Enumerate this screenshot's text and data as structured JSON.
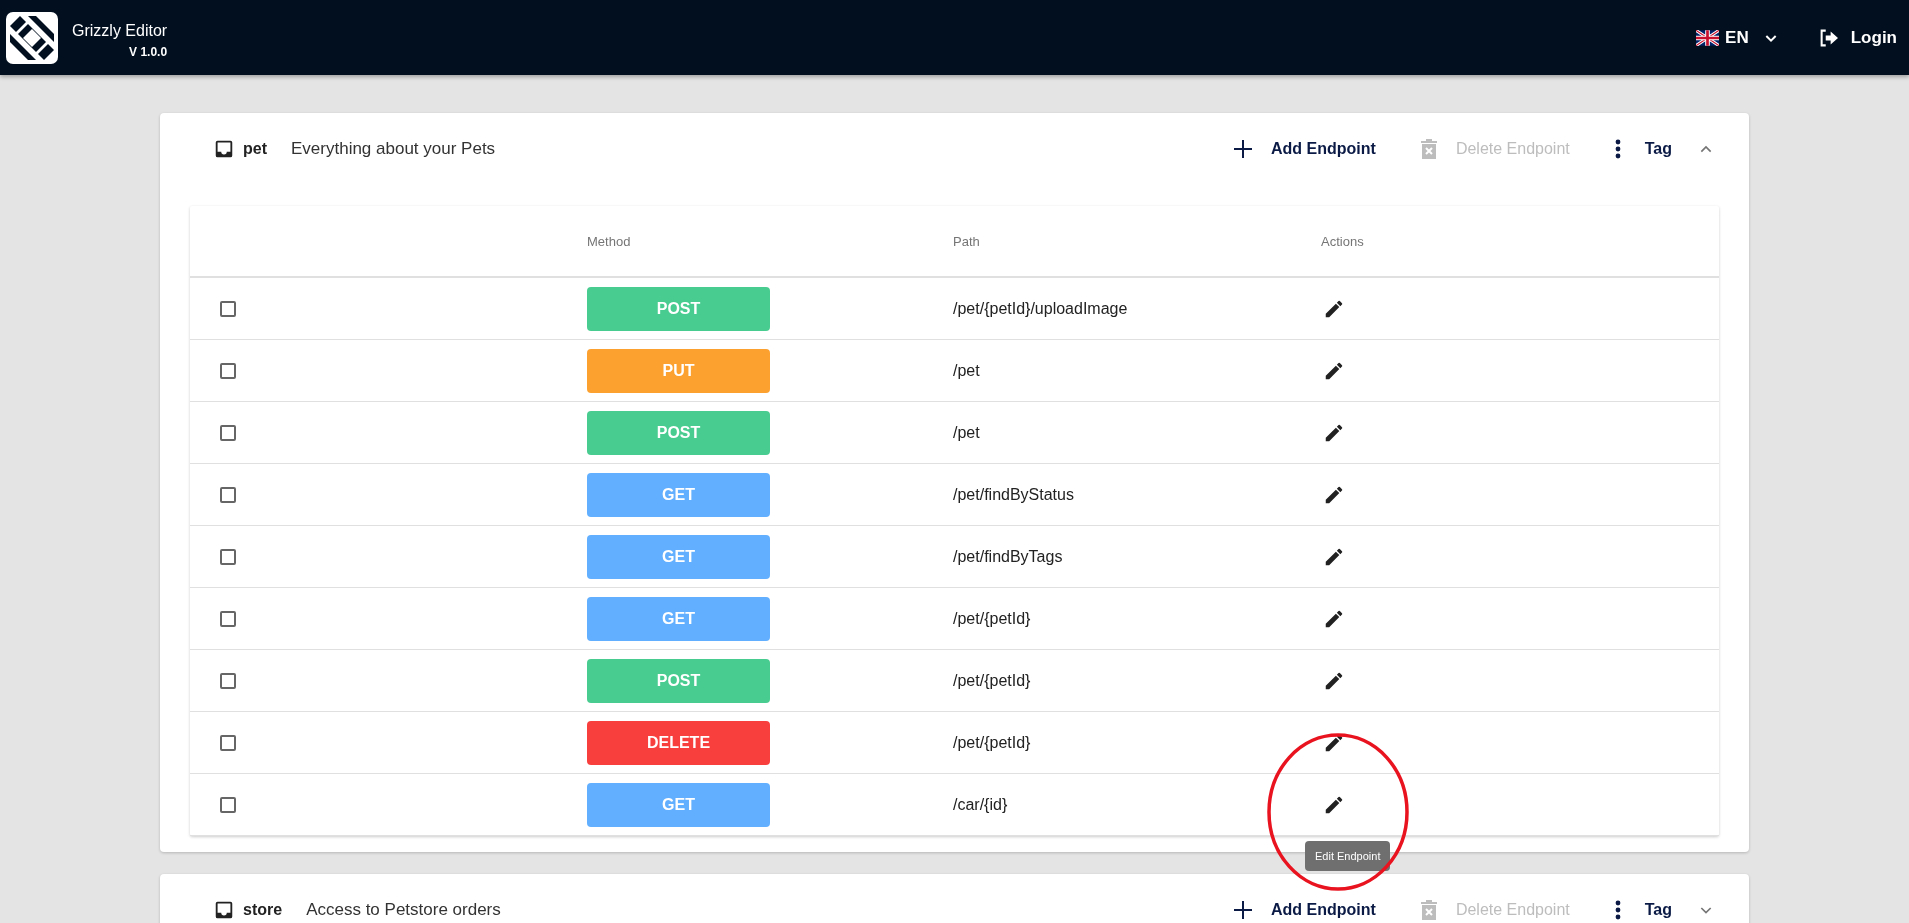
{
  "app": {
    "title": "Grizzly Editor",
    "version": "V 1.0.0",
    "language": "EN",
    "login": "Login"
  },
  "tags": [
    {
      "name": "pet",
      "description": "Everything about your Pets",
      "add_label": "Add Endpoint",
      "delete_label": "Delete Endpoint",
      "delete_disabled": true,
      "tag_label": "Tag",
      "expanded": true,
      "columns": [
        "Method",
        "Path",
        "Actions"
      ],
      "rows": [
        {
          "checked": false,
          "method": "POST",
          "color": "#49cc90",
          "path": "/pet/{petId}/uploadImage"
        },
        {
          "checked": false,
          "method": "PUT",
          "color": "#fca130",
          "path": "/pet"
        },
        {
          "checked": false,
          "method": "POST",
          "color": "#49cc90",
          "path": "/pet"
        },
        {
          "checked": false,
          "method": "GET",
          "color": "#61affe",
          "path": "/pet/findByStatus"
        },
        {
          "checked": false,
          "method": "GET",
          "color": "#61affe",
          "path": "/pet/findByTags"
        },
        {
          "checked": false,
          "method": "GET",
          "color": "#61affe",
          "path": "/pet/{petId}"
        },
        {
          "checked": false,
          "method": "POST",
          "color": "#49cc90",
          "path": "/pet/{petId}"
        },
        {
          "checked": false,
          "method": "DELETE",
          "color": "#f93e3e",
          "path": "/pet/{petId}"
        },
        {
          "checked": false,
          "method": "GET",
          "color": "#61affe",
          "path": "/car/{id}",
          "tooltip": "Edit Endpoint"
        }
      ]
    },
    {
      "name": "store",
      "description": "Access to Petstore orders",
      "add_label": "Add Endpoint",
      "delete_label": "Delete Endpoint",
      "delete_disabled": true,
      "tag_label": "Tag",
      "expanded": false
    }
  ]
}
